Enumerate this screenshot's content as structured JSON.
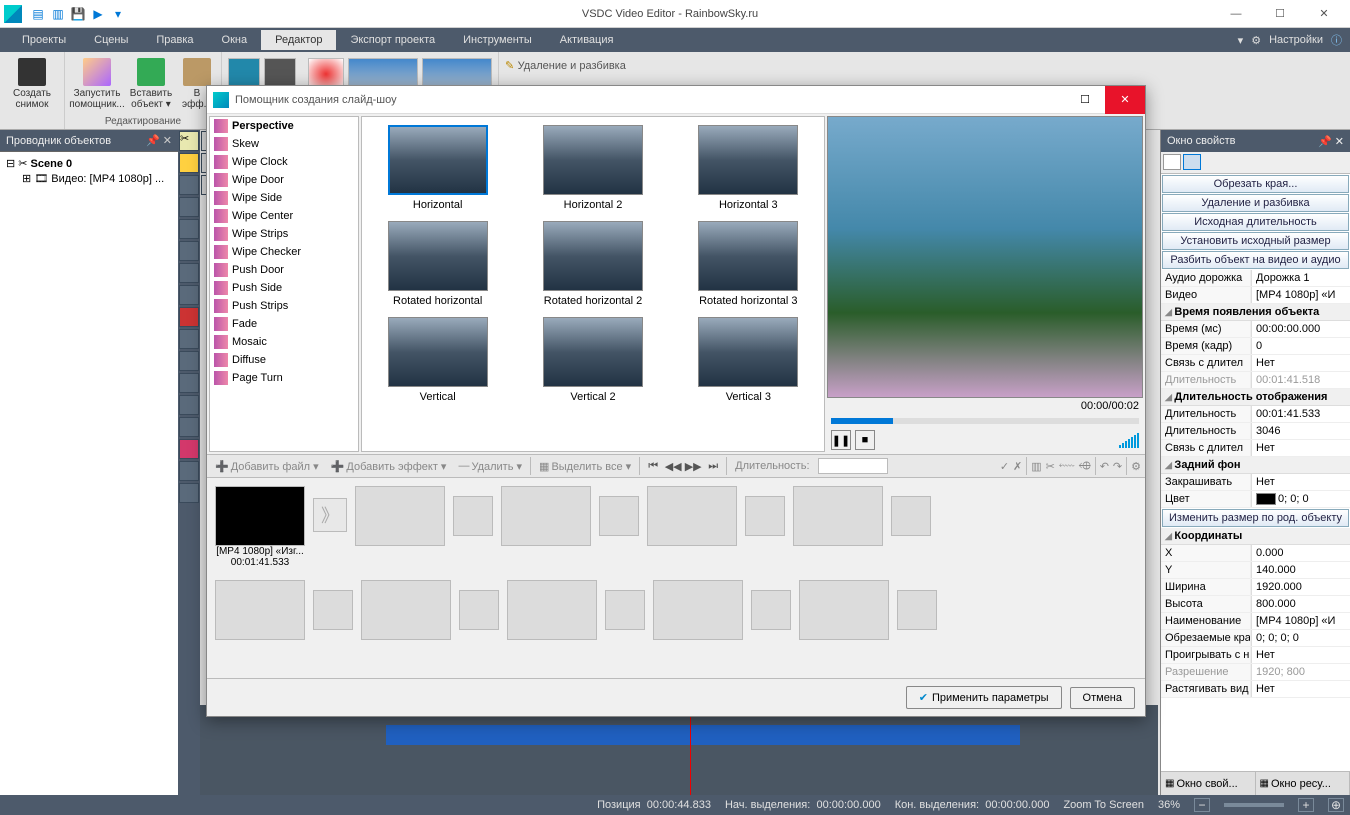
{
  "app": {
    "title": "VSDC Video Editor - RainbowSky.ru"
  },
  "menu": {
    "items": [
      "Проекты",
      "Сцены",
      "Правка",
      "Окна",
      "Редактор",
      "Экспорт проекта",
      "Инструменты",
      "Активация"
    ],
    "active": 4,
    "settings": "Настройки"
  },
  "ribbon": {
    "groups": [
      {
        "caption": "",
        "buttons": [
          {
            "label": "Создать\nснимок"
          }
        ]
      },
      {
        "caption": "Редактирование",
        "buttons": [
          {
            "label": "Запустить\nпомощник..."
          },
          {
            "label": "Вставить\nобъект ▾"
          },
          {
            "label": "В\nэфф..."
          }
        ]
      }
    ],
    "delsplit": "Удаление и разбивка"
  },
  "explorer": {
    "title": "Проводник объектов",
    "scene": "Scene 0",
    "video": "Видео: [MP4 1080p] ..."
  },
  "modal": {
    "title": "Помощник создания слайд-шоу",
    "transitions": [
      {
        "label": "Perspective",
        "bold": true
      },
      {
        "label": "Skew"
      },
      {
        "label": "Wipe Clock"
      },
      {
        "label": "Wipe Door"
      },
      {
        "label": "Wipe Side"
      },
      {
        "label": "Wipe Center"
      },
      {
        "label": "Wipe Strips"
      },
      {
        "label": "Wipe Checker"
      },
      {
        "label": "Push Door"
      },
      {
        "label": "Push Side"
      },
      {
        "label": "Push Strips"
      },
      {
        "label": "Fade"
      },
      {
        "label": "Mosaic"
      },
      {
        "label": "Diffuse"
      },
      {
        "label": "Page Turn"
      }
    ],
    "grid": [
      {
        "label": "Horizontal",
        "sel": true
      },
      {
        "label": "Horizontal 2"
      },
      {
        "label": "Horizontal 3"
      },
      {
        "label": "Rotated horizontal"
      },
      {
        "label": "Rotated horizontal 2"
      },
      {
        "label": "Rotated horizontal 3"
      },
      {
        "label": "Vertical"
      },
      {
        "label": "Vertical 2"
      },
      {
        "label": "Vertical 3"
      }
    ],
    "previewTime": "00:00/00:02",
    "toolbar": {
      "addfile": "Добавить файл ▾",
      "addeffect": "Добавить эффект ▾",
      "delete": "Удалить ▾",
      "selectall": "Выделить все ▾",
      "duration": "Длительность:"
    },
    "clip": {
      "name": "[MP4 1080p] «Изг...",
      "dur": "00:01:41.533"
    },
    "apply": "Применить параметры",
    "cancel": "Отмена"
  },
  "props": {
    "title": "Окно свойств",
    "buttons": [
      "Обрезать края...",
      "Удаление и разбивка",
      "Исходная длительность",
      "Установить исходный размер",
      "Разбить объект на видео и аудио"
    ],
    "rows": [
      {
        "k": "Аудио дорожка",
        "v": "Дорожка 1"
      },
      {
        "k": "Видео",
        "v": "[MP4 1080p] «И"
      }
    ],
    "grp1": "Время появления объекта",
    "rows1": [
      {
        "k": "Время (мс)",
        "v": "00:00:00.000"
      },
      {
        "k": "Время (кадр)",
        "v": "0"
      },
      {
        "k": "Связь с длител",
        "v": "Нет"
      },
      {
        "k": "Длительность",
        "v": "00:01:41.518",
        "grey": true
      }
    ],
    "grp2": "Длительность отображения",
    "rows2": [
      {
        "k": "Длительность",
        "v": "00:01:41.533"
      },
      {
        "k": "Длительность",
        "v": "3046"
      },
      {
        "k": "Связь с длител",
        "v": "Нет"
      }
    ],
    "grp3": "Задний фон",
    "rows3": [
      {
        "k": "Закрашивать",
        "v": "Нет"
      },
      {
        "k": "Цвет",
        "v": "0; 0; 0",
        "color": "#000"
      }
    ],
    "btn2": "Изменить размер по род. объекту",
    "grp4": "Координаты",
    "rows4": [
      {
        "k": "X",
        "v": "0.000"
      },
      {
        "k": "Y",
        "v": "140.000"
      },
      {
        "k": "Ширина",
        "v": "1920.000"
      },
      {
        "k": "Высота",
        "v": "800.000"
      }
    ],
    "rows5": [
      {
        "k": "Наименование",
        "v": "[MP4 1080p] «И"
      },
      {
        "k": "Обрезаемые кра",
        "v": "0; 0; 0; 0"
      },
      {
        "k": "Проигрывать с н",
        "v": "Нет"
      },
      {
        "k": "Разрешение",
        "v": "1920; 800",
        "grey": true
      },
      {
        "k": "Растягивать вид",
        "v": "Нет"
      }
    ],
    "bottomtabs": [
      "Окно свой...",
      "Окно ресу..."
    ]
  },
  "status": {
    "pos": "Позиция",
    "posv": "00:00:44.833",
    "sel1": "Нач. выделения:",
    "sel1v": "00:00:00.000",
    "sel2": "Кон. выделения:",
    "sel2v": "00:00:00.000",
    "zoom": "Zoom To Screen",
    "pct": "36%"
  }
}
